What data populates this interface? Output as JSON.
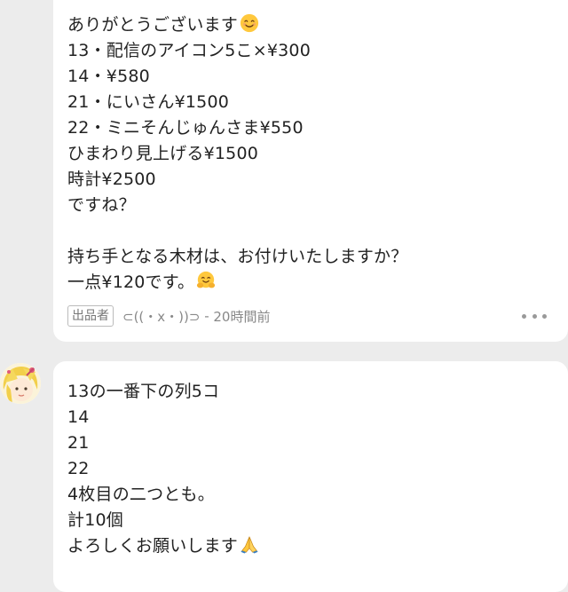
{
  "seller_message": {
    "lines": [
      "ありがとうございます",
      "13・配信のアイコン5こ×¥300",
      "14・¥580",
      "21・にいさん¥1500",
      "22・ミニそんじゅんさま¥550",
      "ひまわり見上げる¥1500",
      "時計¥2500",
      "ですね？",
      "",
      "持ち手となる木材は、お付けいたしますか？",
      "一点¥120です。"
    ],
    "line_emojis": {
      "0": "smiling-face-emoji",
      "10": "hugging-face-emoji"
    },
    "badge_label": "出品者",
    "sender_name": "⊂((・x・))⊃",
    "separator": " - ",
    "timestamp": "20時間前"
  },
  "buyer_message": {
    "lines": [
      "13の一番下の列5コ",
      "14",
      "21",
      "22",
      "4枚目の二つとも。",
      "計10個",
      "よろしくお願いします"
    ],
    "line_emojis": {
      "6": "folded-hands-emoji"
    }
  },
  "colors": {
    "background": "#ececec",
    "bubble": "#ffffff",
    "text": "#222222",
    "meta_text": "#888888",
    "emoji_face": "#ffc83d"
  },
  "icons": {
    "more": "more-dots-icon",
    "avatar": "user-avatar-illustration"
  }
}
